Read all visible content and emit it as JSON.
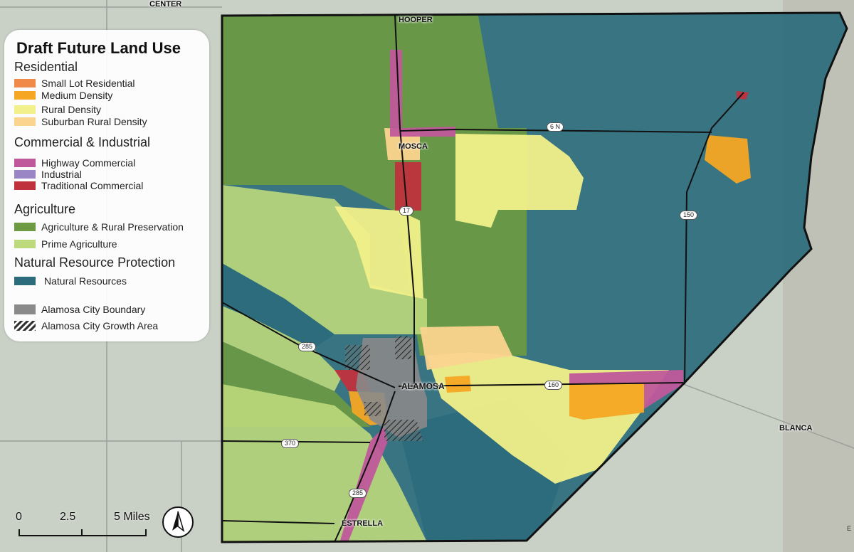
{
  "legend": {
    "title": "Draft Future Land Use",
    "sections": {
      "residential": "Residential",
      "commercial": "Commercial & Industrial",
      "agriculture": "Agriculture",
      "natural": "Natural Resource Protection"
    },
    "items": {
      "small_lot": {
        "label": "Small Lot Residential",
        "color": "#f08a4b"
      },
      "medium": {
        "label": "Medium Density",
        "color": "#f5a623"
      },
      "rural": {
        "label": "Rural Density",
        "color": "#f1f08a"
      },
      "suburban": {
        "label": "Suburban Rural Density",
        "color": "#fbd48f"
      },
      "highway": {
        "label": "Highway Commercial",
        "color": "#c0599b"
      },
      "industrial": {
        "label": "Industrial",
        "color": "#9a86c4"
      },
      "traditional": {
        "label": "Traditional Commercial",
        "color": "#c0313e"
      },
      "ag_rural": {
        "label": "Agriculture & Rural Preservation",
        "color": "#6d9a43"
      },
      "prime_ag": {
        "label": "Prime Agriculture",
        "color": "#bcd97c"
      },
      "natural": {
        "label": "Natural Resources",
        "color": "#2b6b7c"
      },
      "city_boundary": {
        "label": "Alamosa City Boundary",
        "color": "#8a8a8a"
      },
      "growth_area": {
        "label": "Alamosa City Growth Area"
      }
    }
  },
  "places": {
    "center": "CENTER",
    "hooper": "HOOPER",
    "mosca": "MOSCA",
    "alamosa": "ALAMOSA",
    "blanca": "BLANCA",
    "estrella": "ESTRELLA"
  },
  "roads": {
    "r17": "17",
    "r6n": "6 N",
    "r150": "150",
    "r285a": "285",
    "r285b": "285",
    "r160": "160",
    "r370": "370"
  },
  "scale": {
    "zero": "0",
    "mid": "2.5",
    "end": "5 Miles"
  },
  "edge_letter": "E",
  "colors": {
    "boundary": "#111111",
    "basemap": "#c9d0c6"
  }
}
